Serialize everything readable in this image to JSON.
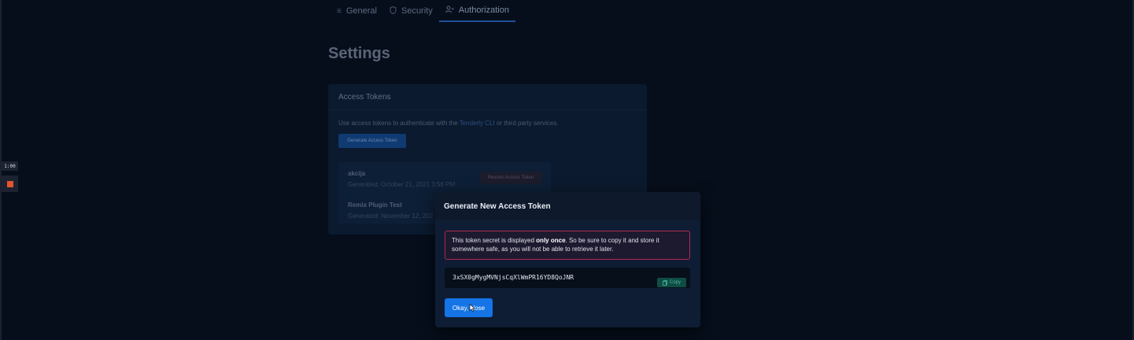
{
  "tabs": [
    {
      "label": "General",
      "icon": "list-icon"
    },
    {
      "label": "Security",
      "icon": "shield-icon"
    },
    {
      "label": "Authorization",
      "icon": "user-key-icon",
      "active": true
    }
  ],
  "page": {
    "title": "Settings"
  },
  "access_tokens": {
    "header": "Access Tokens",
    "description_prefix": "Use access tokens to authenticate with the ",
    "description_link": "Tenderly CLI",
    "description_suffix": " or third party services.",
    "generate_label": "Generate Access Token",
    "tokens": [
      {
        "name": "akcija",
        "generated": "Generated: October 21, 2021 3:56 PM",
        "revoke_label": "Revoke Access Token"
      },
      {
        "name": "Remix Plugin Test",
        "generated": "Generated: November 12, 202"
      }
    ]
  },
  "recorder": {
    "time": "1:00"
  },
  "modal": {
    "title": "Generate New Access Token",
    "alert_prefix": "This token secret is displayed ",
    "alert_bold": "only once",
    "alert_suffix": ". So be sure to copy it and store it somewhere safe, as you will not be able to retrieve it later.",
    "secret": "3xSX0gMygMVNjsCqXlWmPR16YD8QoJNR",
    "copy_label": "Copy",
    "close_label": "Okay, close"
  },
  "colors": {
    "background": "#060e1b",
    "primary": "#1574e6",
    "danger_border": "#b0284f",
    "copy_bg": "#0f4d44"
  }
}
